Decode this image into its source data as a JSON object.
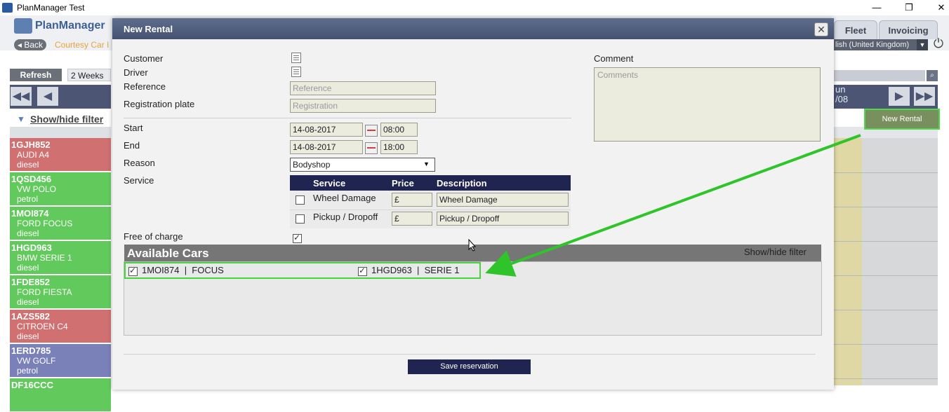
{
  "window": {
    "title": "PlanManager Test",
    "minimize": "—",
    "restore": "❐",
    "close": "✕"
  },
  "app": {
    "logo_text": "PlanManager",
    "back_label": "◂ Back",
    "courtesy_label": "Courtesy Car I",
    "tabs": [
      "Fleet",
      "Invoicing"
    ],
    "language": "lish (United Kingdom)",
    "refresh_label": "Refresh",
    "weeks_label": "2 Weeks",
    "filter_label": "Show/hide filter",
    "day_label": "un\n/08",
    "new_rental_label": "New Rental",
    "cars": [
      {
        "plate": "1GJH852",
        "model": "AUDI A4",
        "fuel": "diesel",
        "color": "#d07070"
      },
      {
        "plate": "1QSD456",
        "model": "VW POLO",
        "fuel": "petrol",
        "color": "#62ca5c"
      },
      {
        "plate": "1MOI874",
        "model": "FORD FOCUS",
        "fuel": "diesel",
        "color": "#62ca5c"
      },
      {
        "plate": "1HGD963",
        "model": "BMW SERIE 1",
        "fuel": "diesel",
        "color": "#62ca5c"
      },
      {
        "plate": "1FDE852",
        "model": "FORD FIESTA",
        "fuel": "diesel",
        "color": "#62ca5c"
      },
      {
        "plate": "1AZS582",
        "model": "CITROEN C4",
        "fuel": "diesel",
        "color": "#d07070"
      },
      {
        "plate": "1ERD785",
        "model": "VW GOLF",
        "fuel": "petrol",
        "color": "#7a80b8"
      },
      {
        "plate": "DF16CCC",
        "model": "",
        "fuel": "",
        "color": "#62ca5c"
      }
    ]
  },
  "modal": {
    "title": "New Rental",
    "close_glyph": "✕",
    "labels": {
      "customer": "Customer",
      "driver": "Driver",
      "reference": "Reference",
      "registration": "Registration plate",
      "start": "Start",
      "end": "End",
      "reason": "Reason",
      "service": "Service",
      "free_of_charge": "Free of charge",
      "comment": "Comment"
    },
    "reference_placeholder": "Reference",
    "registration_placeholder": "Registration",
    "start_date": "14-08-2017",
    "start_time": "08:00",
    "end_date": "14-08-2017",
    "end_time": "18:00",
    "reason_value": "Bodyshop",
    "service_table": {
      "headers": [
        "Service",
        "Price",
        "Description"
      ],
      "rows": [
        {
          "service": "Wheel Damage",
          "price": "£",
          "description": "Wheel Damage"
        },
        {
          "service": "Pickup / Dropoff",
          "price": "£",
          "description": "Pickup / Dropoff"
        }
      ]
    },
    "comments_placeholder": "Comments",
    "available_cars": {
      "title": "Available Cars",
      "filter_label": "Show/hide filter",
      "cars": [
        "1MOI874  |  FOCUS",
        "1HGD963  |  SERIE 1"
      ]
    },
    "save_label": "Save reservation"
  },
  "colors": {
    "modal_header": "#4c5674",
    "table_header": "#1f2450",
    "highlight": "#43d43e"
  }
}
